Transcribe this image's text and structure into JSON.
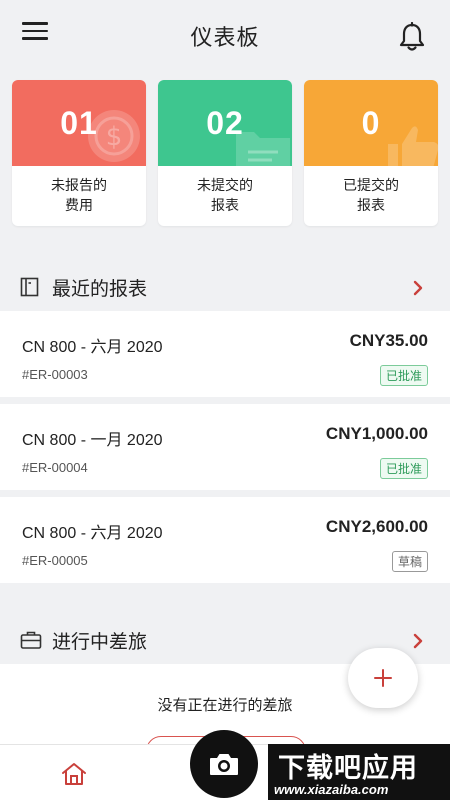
{
  "header": {
    "title": "仪表板",
    "menu_icon": "hamburger-menu-icon",
    "bell_icon": "bell-icon"
  },
  "cards": [
    {
      "count": "01",
      "label": "未报告的\n费用",
      "color": "#f26c5f",
      "icon": "dollar-coin-icon"
    },
    {
      "count": "02",
      "label": "未提交的\n报表",
      "color": "#3ec68f",
      "icon": "folder-icon"
    },
    {
      "count": "0",
      "label": "已提交的\n报表",
      "color": "#f7a737",
      "icon": "thumbs-up-icon"
    }
  ],
  "recent_reports": {
    "title": "最近的报表",
    "items": [
      {
        "name": "CN 800 - 六月 2020",
        "amount": "CNY35.00",
        "id": "#ER-00003",
        "status": "已批准",
        "status_type": "approved"
      },
      {
        "name": "CN 800 - 一月 2020",
        "amount": "CNY1,000.00",
        "id": "#ER-00004",
        "status": "已批准",
        "status_type": "approved"
      },
      {
        "name": "CN 800 - 六月 2020",
        "amount": "CNY2,600.00",
        "id": "#ER-00005",
        "status": "草稿",
        "status_type": "draft"
      }
    ]
  },
  "trips": {
    "title": "进行中差旅",
    "empty_text": "没有正在进行的差旅"
  },
  "watermark": {
    "main": "下载吧应用",
    "sub": "www.xiazaiba.com"
  },
  "colors": {
    "accent_red": "#d9534f",
    "approved_green": "#2e9b5a"
  }
}
